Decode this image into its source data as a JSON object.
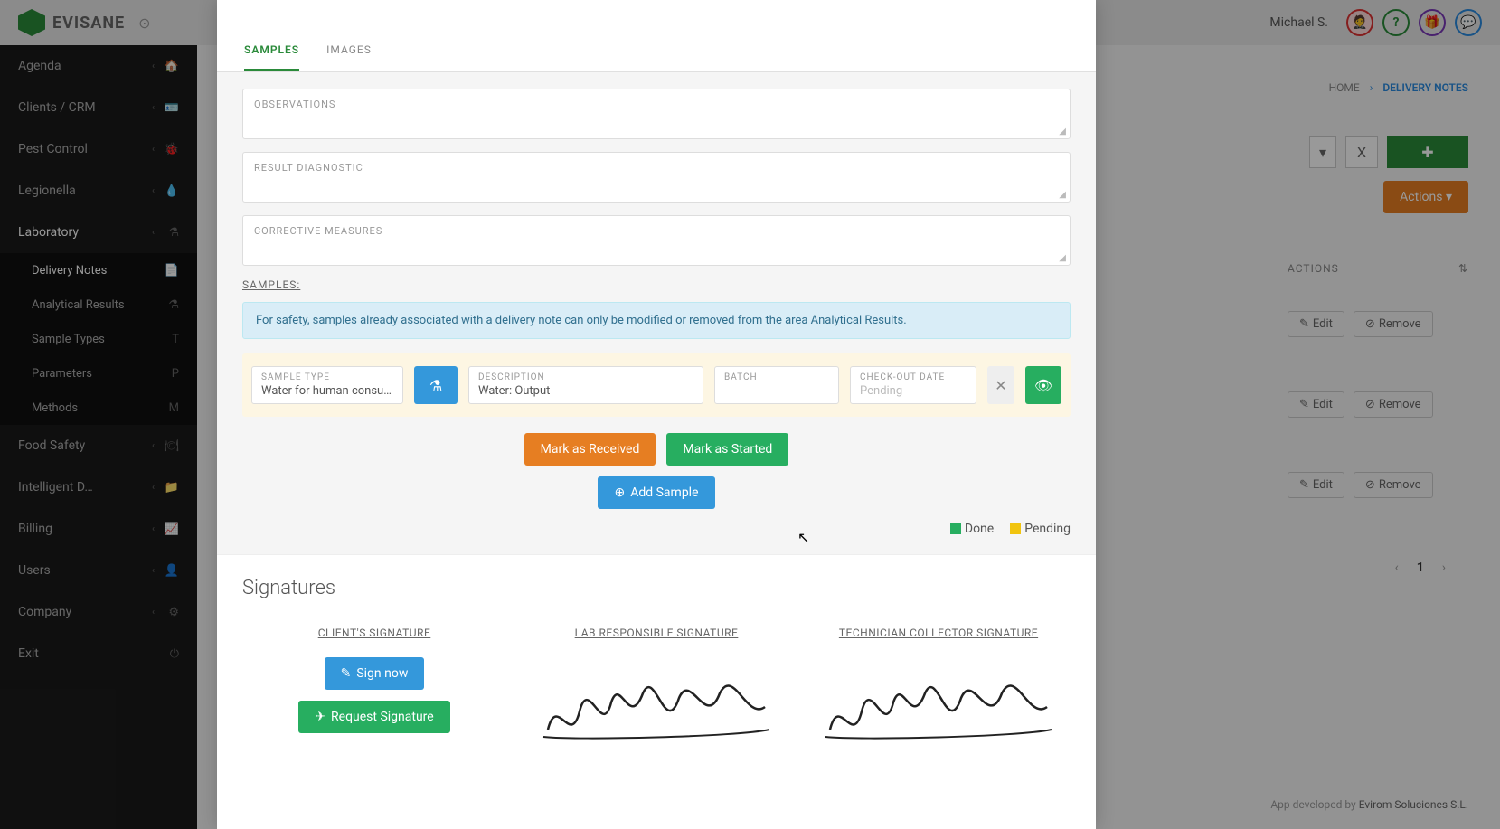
{
  "header": {
    "logo_text": "EVISANE",
    "user_name": "Michael S.",
    "icons": {
      "avatar": "👤",
      "help": "?",
      "gift": "🎁",
      "chat": "💬"
    }
  },
  "breadcrumb": {
    "home": "HOME",
    "sep": "›",
    "current": "DELIVERY NOTES"
  },
  "top_controls": {
    "x": "X",
    "add": "+"
  },
  "actions_button": "Actions",
  "bg_table": {
    "header": "ACTIONS",
    "edit": "Edit",
    "remove": "Remove"
  },
  "pagination": {
    "prev": "‹",
    "page": "1",
    "next": "›"
  },
  "footer": {
    "pre": "App developed by ",
    "company": "Evirom Soluciones S.L."
  },
  "sidebar": {
    "items": [
      {
        "label": "Agenda",
        "icon": "🏠"
      },
      {
        "label": "Clients / CRM",
        "icon": "🪪"
      },
      {
        "label": "Pest Control",
        "icon": "🐞"
      },
      {
        "label": "Legionella",
        "icon": "💧"
      },
      {
        "label": "Laboratory",
        "icon": "⚗"
      }
    ],
    "sub": [
      {
        "label": "Delivery Notes",
        "icon": "📄"
      },
      {
        "label": "Analytical Results",
        "icon": "⚗"
      },
      {
        "label": "Sample Types",
        "icon": "T"
      },
      {
        "label": "Parameters",
        "icon": "P"
      },
      {
        "label": "Methods",
        "icon": "M"
      }
    ],
    "items2": [
      {
        "label": "Food Safety",
        "icon": "🍽"
      },
      {
        "label": "Intelligent D…",
        "icon": "📁"
      },
      {
        "label": "Billing",
        "icon": "📈"
      },
      {
        "label": "Users",
        "icon": "👤"
      },
      {
        "label": "Company",
        "icon": "⚙"
      },
      {
        "label": "Exit",
        "icon": "⏻"
      }
    ]
  },
  "modal": {
    "tabs": {
      "samples": "SAMPLES",
      "images": "IMAGES"
    },
    "fields": {
      "observations": "OBSERVATIONS",
      "result_diagnostic": "RESULT DIAGNOSTIC",
      "corrective_measures": "CORRECTIVE MEASURES"
    },
    "samples_header": "SAMPLES:",
    "info": "For safety, samples already associated with a delivery note can only be modified or removed from the area Analytical Results.",
    "sample": {
      "type_label": "SAMPLE TYPE",
      "type_value": "Water for human consum…",
      "desc_label": "DESCRIPTION",
      "desc_value": "Water: Output",
      "batch_label": "BATCH",
      "batch_value": "",
      "date_label": "CHECK-OUT DATE",
      "date_value": "Pending"
    },
    "buttons": {
      "received": "Mark as Received",
      "started": "Mark as Started",
      "add_sample": "Add Sample"
    },
    "legend": {
      "done": "Done",
      "pending": "Pending"
    },
    "signatures": {
      "title": "Signatures",
      "client": "CLIENT'S SIGNATURE",
      "lab": "LAB RESPONSIBLE SIGNATURE",
      "tech": "TECHNICIAN COLLECTOR SIGNATURE",
      "sign_now": "Sign now",
      "request": "Request Signature"
    }
  }
}
